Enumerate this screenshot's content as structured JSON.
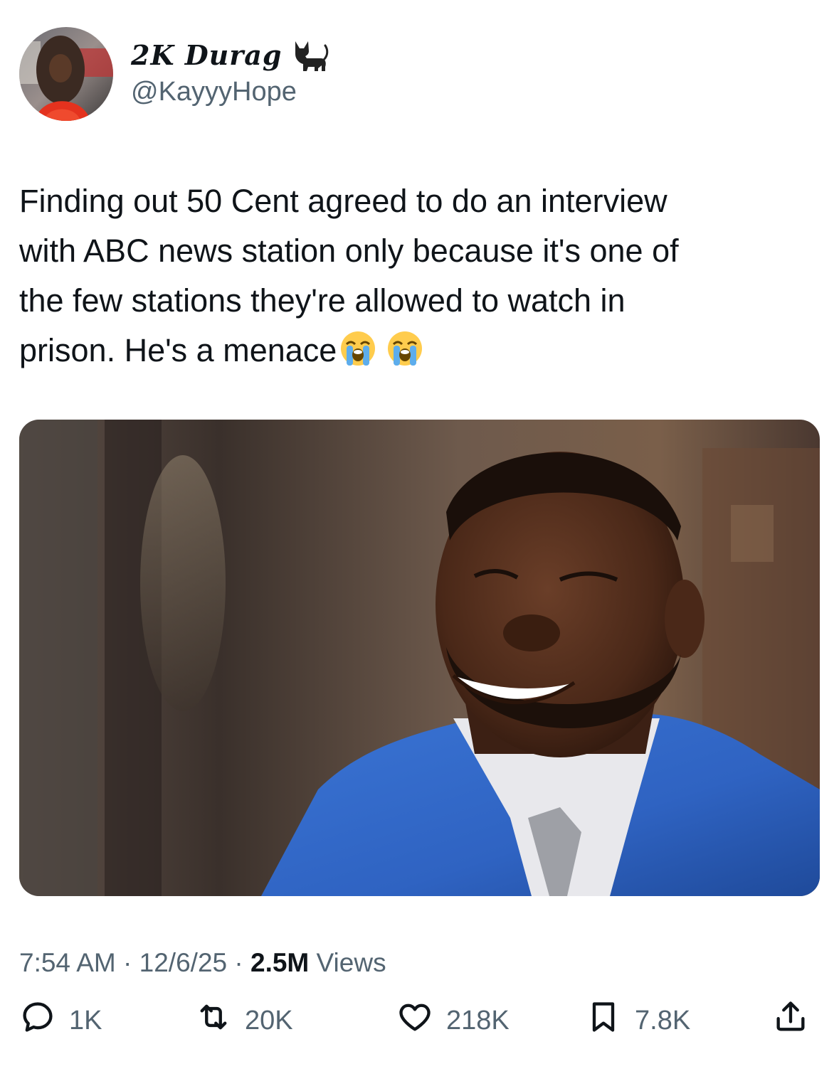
{
  "author": {
    "display_name": "2K Durag",
    "display_icon": "cat-icon",
    "handle": "@KayyyHope",
    "avatar": "profile-photo"
  },
  "tweet": {
    "text": "Finding out 50 Cent agreed to do an interview\nwith ABC news station only because it's one of\nthe few stations they're allowed to watch in\nprison. He's a menace",
    "emojis": [
      "loudly-crying-face-icon",
      "loudly-crying-face-icon"
    ]
  },
  "media": {
    "type": "photo"
  },
  "meta": {
    "time": "7:54 AM",
    "separator": "·",
    "date": "12/6/25",
    "views_count": "2.5M",
    "views_label": "Views"
  },
  "actions": {
    "reply": {
      "icon": "reply-icon",
      "count": "1K"
    },
    "retweet": {
      "icon": "retweet-icon",
      "count": "20K"
    },
    "like": {
      "icon": "heart-icon",
      "count": "218K"
    },
    "bookmark": {
      "icon": "bookmark-icon",
      "count": "7.8K"
    },
    "share": {
      "icon": "share-icon"
    }
  },
  "colors": {
    "text_primary": "#0f1419",
    "text_secondary": "#536471",
    "suit_blue": "#2f63c2"
  }
}
